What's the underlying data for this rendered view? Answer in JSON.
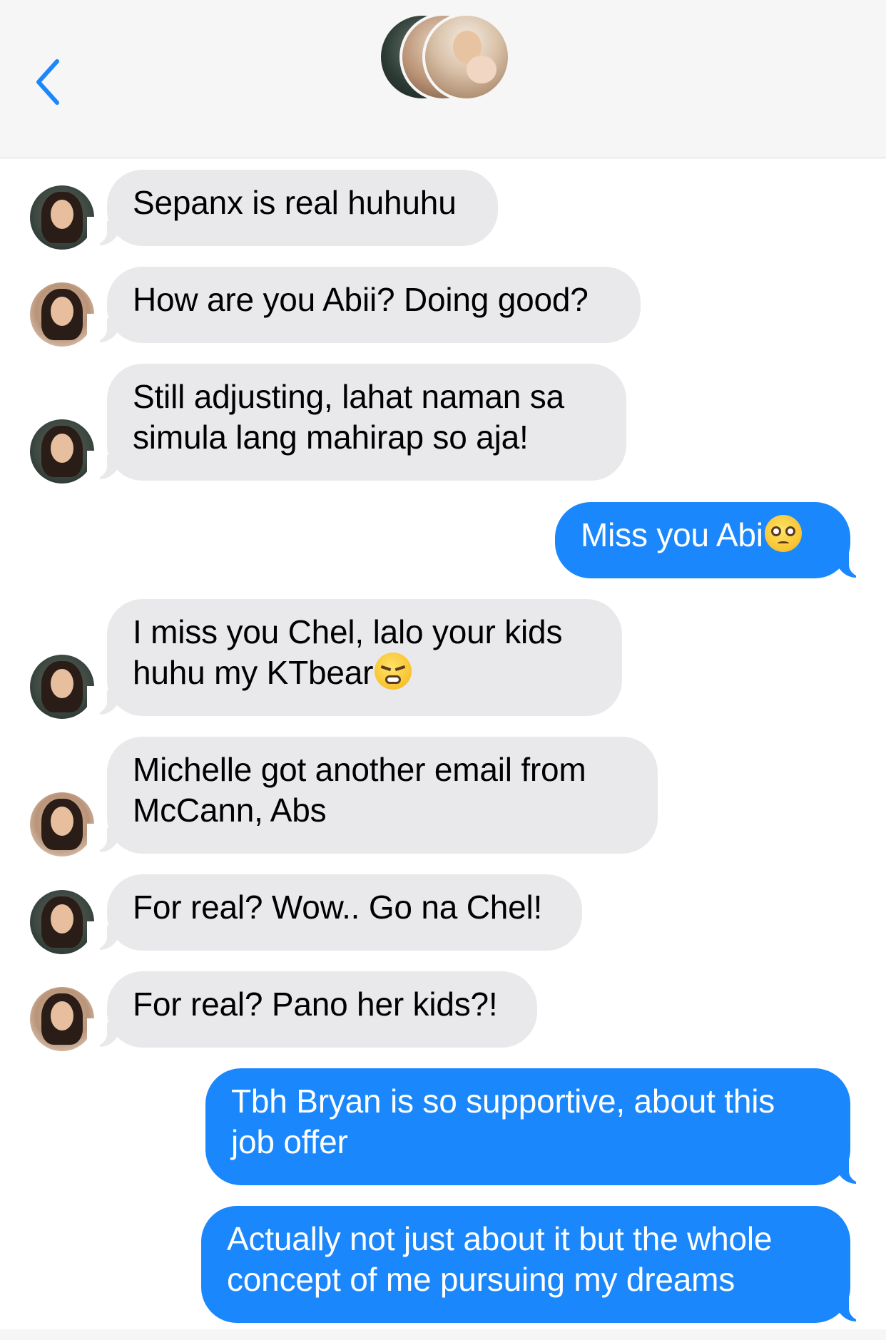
{
  "header": {
    "back_icon": "chevron-left-icon",
    "accent": "#1b87fd"
  },
  "messages": [
    {
      "direction": "incoming",
      "sender": "dark",
      "text": "Sepanx is real huhuhu"
    },
    {
      "direction": "incoming",
      "sender": "light",
      "text": "How are you Abii? Doing good?"
    },
    {
      "direction": "incoming",
      "sender": "dark",
      "lines": [
        "Still adjusting, lahat naman sa",
        "simula lang mahirap so aja!"
      ]
    },
    {
      "direction": "outgoing",
      "text": "Miss you Abi",
      "emoji": "pleading-face-icon"
    },
    {
      "direction": "incoming",
      "sender": "dark",
      "lines": [
        "I miss you Chel, lalo your kids",
        "huhu my KTbear"
      ],
      "emoji": "tired-face-icon"
    },
    {
      "direction": "incoming",
      "sender": "light",
      "lines": [
        "Michelle got another email from",
        "McCann, Abs"
      ]
    },
    {
      "direction": "incoming",
      "sender": "dark",
      "text": "For real? Wow.. Go na Chel!"
    },
    {
      "direction": "incoming",
      "sender": "light",
      "text": "For real? Pano her kids?!"
    },
    {
      "direction": "outgoing",
      "lines": [
        "Tbh Bryan is so supportive, about this",
        "job offer"
      ]
    },
    {
      "direction": "outgoing",
      "lines": [
        "Actually not just about it but the whole",
        "concept of me pursuing my dreams"
      ]
    }
  ],
  "colors": {
    "incoming_bubble": "#e9e9eb",
    "outgoing_bubble": "#1b87fd"
  }
}
